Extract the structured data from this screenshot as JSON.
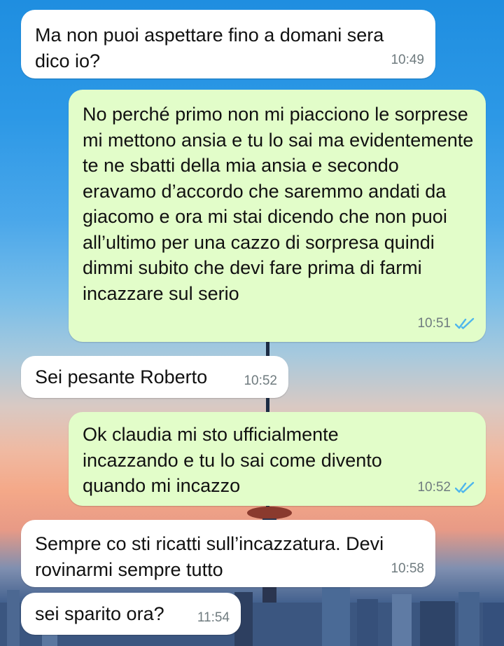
{
  "colors": {
    "incoming_bubble": "#ffffff",
    "outgoing_bubble": "#e2fdc9",
    "read_ticks": "#4fb6ec",
    "timestamp": "#6f7b7f"
  },
  "messages": [
    {
      "direction": "incoming",
      "text": "Ma non puoi aspettare fino a domani sera dico io?",
      "time": "10:49"
    },
    {
      "direction": "outgoing",
      "text": "No perché primo non mi piacciono le sorprese mi mettono ansia e tu lo sai ma evidentemente te ne sbatti della mia ansia e secondo eravamo d’accordo che saremmo andati da giacomo e ora mi stai dicendo che non puoi all’ultimo per una cazzo di sorpresa quindi dimmi subito che devi fare prima di farmi incazzare sul serio",
      "time": "10:51",
      "status_icon": "double-check-read-icon"
    },
    {
      "direction": "incoming",
      "text": "Sei pesante Roberto",
      "time": "10:52"
    },
    {
      "direction": "outgoing",
      "text": "Ok claudia mi sto ufficialmente incazzando e tu lo sai come divento quando mi incazzo",
      "time": "10:52",
      "status_icon": "double-check-read-icon"
    },
    {
      "direction": "incoming",
      "text": "Sempre co sti ricatti sull’incazzatura. Devi rovinarmi sempre tutto",
      "time": "10:58"
    },
    {
      "direction": "incoming",
      "text": "sei sparito ora?",
      "time": "11:54"
    }
  ]
}
